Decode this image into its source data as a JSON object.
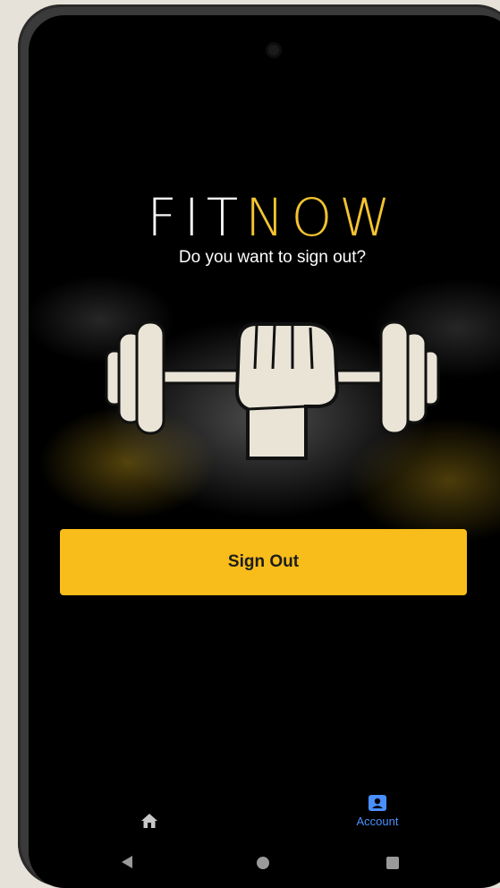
{
  "app": {
    "logo_part1": "FIT",
    "logo_part2": "NOW",
    "prompt": "Do you want to sign out?",
    "colors": {
      "accent": "#f8bd1a",
      "logo_accent": "#f4c430",
      "nav_active": "#4a8fff"
    }
  },
  "actions": {
    "signout_label": "Sign Out"
  },
  "bottom_nav": {
    "items": [
      {
        "icon": "home-icon",
        "label": "",
        "active": false
      },
      {
        "icon": "account-icon",
        "label": "Account",
        "active": true
      }
    ]
  },
  "system_nav": {
    "icons": [
      "back-icon",
      "home-circle-icon",
      "recents-icon"
    ]
  }
}
